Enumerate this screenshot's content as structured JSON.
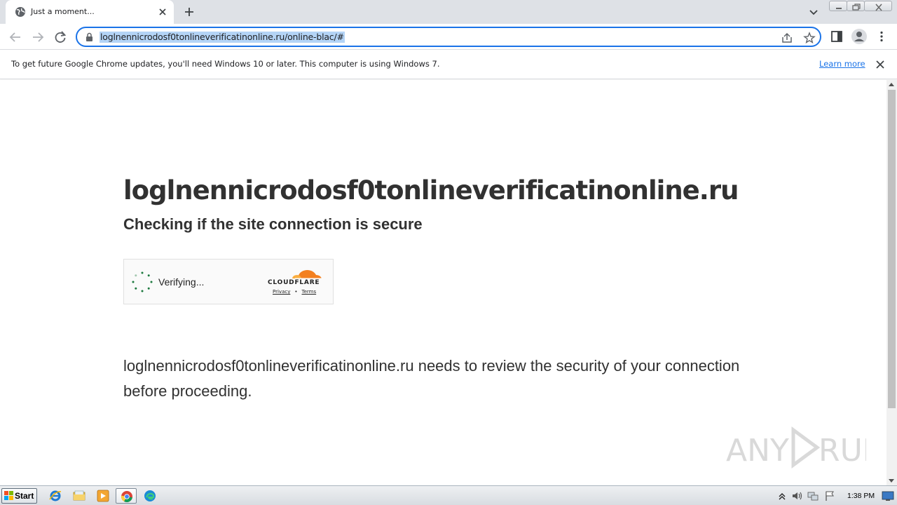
{
  "browser": {
    "tab_title": "Just a moment...",
    "url": "loglnennicrodosf0tonlineverificatinonline.ru/online-blac/#",
    "icons": {
      "favicon": "globe-icon",
      "tab_close": "close-icon",
      "new_tab": "plus-icon",
      "back": "arrow-left-icon",
      "forward": "arrow-right-icon",
      "reload": "reload-icon",
      "lock": "lock-icon",
      "share": "share-icon",
      "bookmark": "star-icon",
      "side_panel": "side-panel-icon",
      "profile": "profile-icon",
      "menu": "kebab-menu-icon"
    },
    "accent_color": "#1a73e8"
  },
  "infobar": {
    "message": "To get future Google Chrome updates, you'll need Windows 10 or later. This computer is using Windows 7.",
    "link": "Learn more"
  },
  "page": {
    "domain": "loglnennicrodosf0tonlineverificatinonline.ru",
    "subtitle": "Checking if the site connection is secure",
    "widget": {
      "status": "Verifying...",
      "brand": "CLOUDFLARE",
      "privacy": "Privacy",
      "separator": "•",
      "terms": "Terms",
      "brand_color": "#f38020",
      "spinner_color": "#1d7a3f"
    },
    "description": "loglnennicrodosf0tonlineverificatinonline.ru needs to review the security of your connection before proceeding.",
    "watermark": "ANY RUN"
  },
  "taskbar": {
    "start_label": "Start",
    "apps": [
      "internet-explorer-icon",
      "folder-icon",
      "media-player-icon",
      "chrome-icon",
      "edge-icon"
    ],
    "clock": "1:38 PM"
  }
}
